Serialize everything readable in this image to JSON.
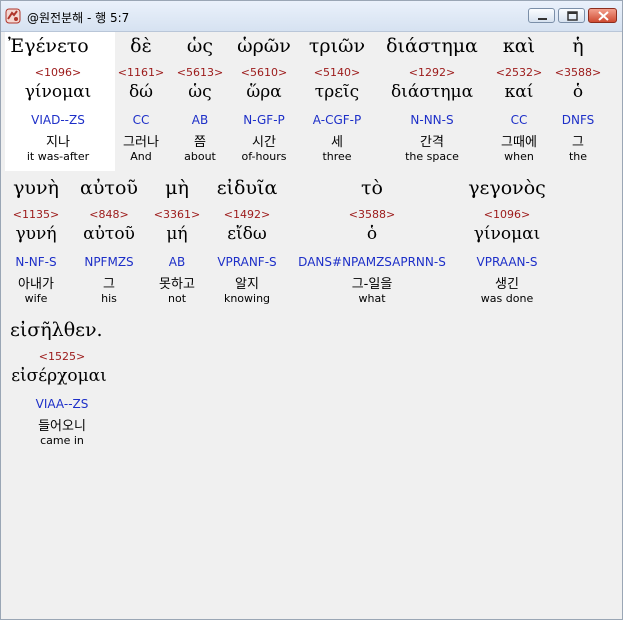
{
  "window": {
    "title": "@원전분해 - 행 5:7",
    "controls": [
      "minimize",
      "maximize",
      "close"
    ],
    "app_icon": "hand-pointer-icon",
    "accent": "#cf4b32"
  },
  "rows": [
    [
      {
        "greek": "Ἐγένετο",
        "num": "<1096>",
        "lemma": "γίνομαι",
        "parse": "VIAD--ZS",
        "kor": "지나",
        "eng": "it was-after"
      },
      {
        "greek": "δὲ",
        "num": "<1161>",
        "lemma": "δώ",
        "parse": "CC",
        "kor": "그러나",
        "eng": "And"
      },
      {
        "greek": "ὡς",
        "num": "<5613>",
        "lemma": "ὡς",
        "parse": "AB",
        "kor": "쯤",
        "eng": "about"
      },
      {
        "greek": "ὡρῶν",
        "num": "<5610>",
        "lemma": "ὥρα",
        "parse": "N-GF-P",
        "kor": "시간",
        "eng": "of-hours"
      },
      {
        "greek": "τριῶν",
        "num": "<5140>",
        "lemma": "τρεῖς",
        "parse": "A-CGF-P",
        "kor": "세",
        "eng": "three"
      },
      {
        "greek": "διάστημα",
        "num": "<1292>",
        "lemma": "διάστημα",
        "parse": "N-NN-S",
        "kor": "간격",
        "eng": "the space"
      },
      {
        "greek": "καὶ",
        "num": "<2532>",
        "lemma": "καί",
        "parse": "CC",
        "kor": "그때에",
        "eng": "when"
      },
      {
        "greek": "ἡ",
        "num": "<3588>",
        "lemma": "ὁ",
        "parse": "DNFS",
        "kor": "그",
        "eng": "the"
      }
    ],
    [
      {
        "greek": "γυνὴ",
        "num": "<1135>",
        "lemma": "γυνή",
        "parse": "N-NF-S",
        "kor": "아내가",
        "eng": "wife"
      },
      {
        "greek": "αὐτοῦ",
        "num": "<848>",
        "lemma": "αὐτοῦ",
        "parse": "NPFMZS",
        "kor": "그",
        "eng": "his"
      },
      {
        "greek": "μὴ",
        "num": "<3361>",
        "lemma": "μή",
        "parse": "AB",
        "kor": "못하고",
        "eng": "not"
      },
      {
        "greek": "εἰδυῖα",
        "num": "<1492>",
        "lemma": "εἴδω",
        "parse": "VPRANF-S",
        "kor": "알지",
        "eng": "knowing"
      },
      {
        "greek": "τὸ",
        "num": "<3588>",
        "lemma": "ὁ",
        "parse": "DANS#NPAMZSAPRNN-S",
        "kor": "그-일을",
        "eng": "what"
      },
      {
        "greek": "γεγονὸς",
        "num": "<1096>",
        "lemma": "γίνομαι",
        "parse": "VPRAAN-S",
        "kor": "생긴",
        "eng": "was done"
      }
    ],
    [
      {
        "greek": "εἰσῆλθεν.",
        "num": "<1525>",
        "lemma": "εἰσέρχομαι",
        "parse": "VIAA--ZS",
        "kor": "들어오니",
        "eng": "came in"
      }
    ]
  ]
}
